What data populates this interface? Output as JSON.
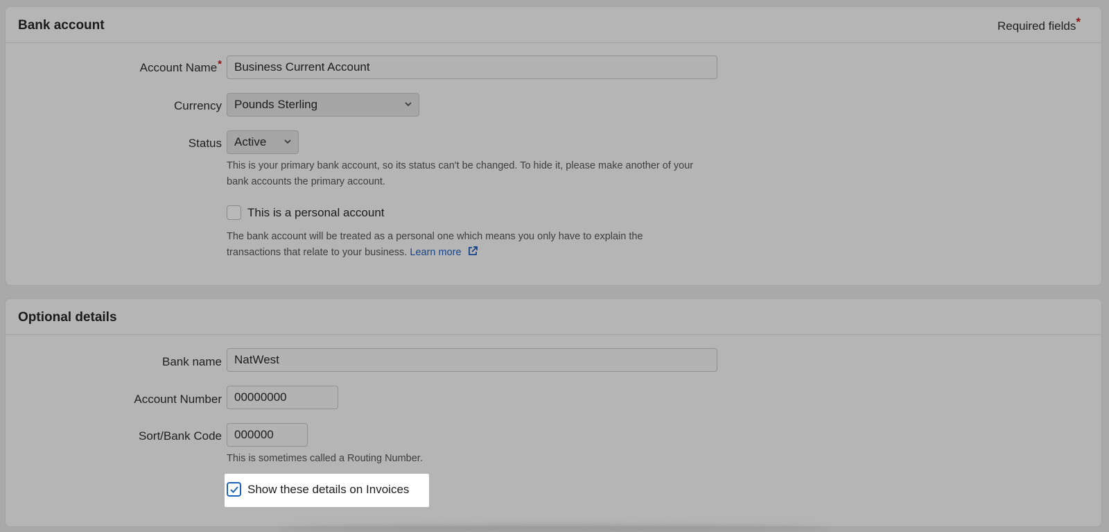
{
  "bank_account": {
    "title": "Bank account",
    "required_note": "Required fields",
    "required_star": "*",
    "account_name": {
      "label": "Account Name",
      "star": "*",
      "value": "Business Current Account"
    },
    "currency": {
      "label": "Currency",
      "value": "Pounds Sterling"
    },
    "status": {
      "label": "Status",
      "value": "Active",
      "help": "This is your primary bank account, so its status can't be changed. To hide it, please make another of your bank accounts the primary account."
    },
    "personal": {
      "label": "This is a personal account",
      "checked": false,
      "help": "The bank account will be treated as a personal one which means you only have to explain the transactions that relate to your business.",
      "link": "Learn more",
      "link_icon": "external-link-icon"
    }
  },
  "optional_details": {
    "title": "Optional details",
    "bank_name": {
      "label": "Bank name",
      "value": "NatWest"
    },
    "account_number": {
      "label": "Account Number",
      "value": "00000000"
    },
    "sort_code": {
      "label": "Sort/Bank Code",
      "value": "000000",
      "help": "This is sometimes called a Routing Number."
    },
    "show_on_invoices": {
      "label": "Show these details on Invoices",
      "checked": true
    }
  },
  "colors": {
    "accent": "#1e63b8",
    "required": "#8a1010",
    "link": "#17438a"
  }
}
